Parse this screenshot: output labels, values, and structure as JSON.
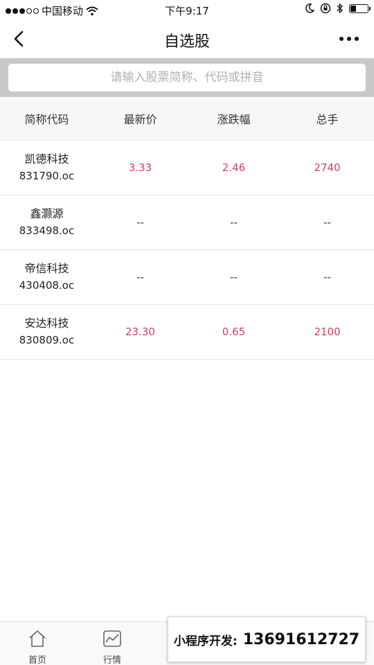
{
  "status_bar": {
    "carrier": "中国移动",
    "time": "下午9:17",
    "battery_level": 0.35
  },
  "navbar": {
    "title": "自选股",
    "back_icon": "chevron-left-icon",
    "more_icon": "more-dots-icon"
  },
  "search": {
    "placeholder": "请输入股票简称、代码或拼音",
    "value": ""
  },
  "table": {
    "headers": [
      "简称代码",
      "最新价",
      "涨跌幅",
      "总手"
    ],
    "rows": [
      {
        "name": "凯德科技",
        "code": "831790.oc",
        "price": "3.33",
        "change": "2.46",
        "volume": "2740",
        "color": "#d0425a"
      },
      {
        "name": "鑫灏源",
        "code": "833498.oc",
        "price": "--",
        "change": "--",
        "volume": "--",
        "color": "#333333"
      },
      {
        "name": "帝信科技",
        "code": "430408.oc",
        "price": "--",
        "change": "--",
        "volume": "--",
        "color": "#333333"
      },
      {
        "name": "安达科技",
        "code": "830809.oc",
        "price": "23.30",
        "change": "0.65",
        "volume": "2100",
        "color": "#d0425a"
      }
    ]
  },
  "tabbar": {
    "tabs": [
      {
        "label": "首页",
        "icon": "home-icon"
      },
      {
        "label": "行情",
        "icon": "chart-icon"
      }
    ]
  },
  "promo": {
    "label": "小程序开发:",
    "phone": "13691612727"
  },
  "colors": {
    "up": "#d0425a",
    "neutral": "#333333",
    "search_bg": "#c8c8c8"
  }
}
